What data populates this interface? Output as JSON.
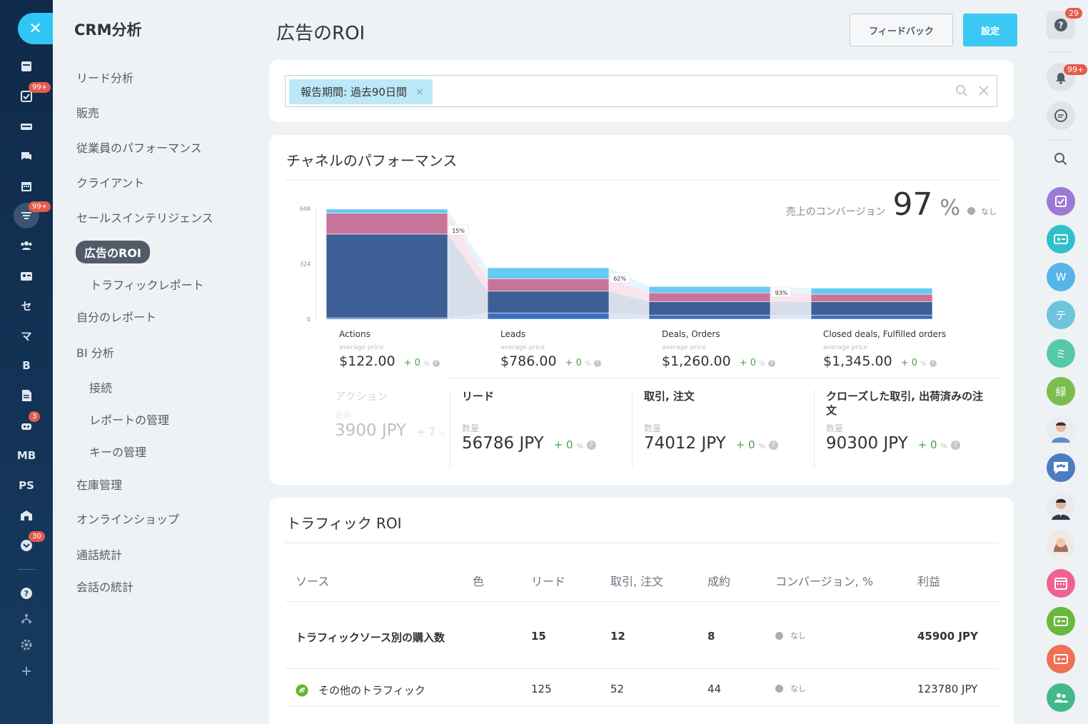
{
  "rail": {
    "close": "✕",
    "items": [
      {
        "label": "",
        "badge": ""
      },
      {
        "label": "",
        "badge": "99+"
      },
      {
        "label": "",
        "badge": ""
      },
      {
        "label": "",
        "badge": ""
      },
      {
        "label": "",
        "badge": ""
      },
      {
        "label": "",
        "badge": "99+"
      },
      {
        "label": "",
        "badge": ""
      },
      {
        "label": "",
        "badge": ""
      },
      {
        "label": "セ",
        "badge": ""
      },
      {
        "label": "マ",
        "badge": ""
      },
      {
        "label": "B",
        "badge": ""
      },
      {
        "label": "",
        "badge": ""
      },
      {
        "label": "",
        "badge": "3"
      },
      {
        "label": "MB",
        "badge": ""
      },
      {
        "label": "PS",
        "badge": ""
      },
      {
        "label": "",
        "badge": ""
      },
      {
        "label": "",
        "badge": "30"
      }
    ]
  },
  "menu": {
    "title": "CRM分析",
    "items": [
      "リード分析",
      "販売",
      "従業員のパフォーマンス",
      "クライアント",
      "セールスインテリジェンス",
      "広告のROI",
      "トラフィックレポート",
      "自分のレポート",
      "BI 分析",
      "接続",
      "レポートの管理",
      "キーの管理",
      "在庫管理",
      "オンラインショップ",
      "通話統計",
      "会話の統計"
    ]
  },
  "header": {
    "title": "広告のROI",
    "feedback": "フィードバック",
    "settings": "設定"
  },
  "filter": {
    "tag": "報告期間: 過去90日間",
    "tag_remove": "×"
  },
  "channel": {
    "title": "チャネルのパフォーマンス",
    "conversion_label": "売上のコンバージョン",
    "conversion_value": "97",
    "conversion_unit": "%",
    "conversion_none": "なし",
    "stages": [
      {
        "name": "Actions",
        "sub": "average price",
        "price": "$122.00",
        "delta": "+ 0",
        "unit": "%"
      },
      {
        "name": "Leads",
        "sub": "average price",
        "price": "$786.00",
        "delta": "+ 0",
        "unit": "%"
      },
      {
        "name": "Deals, Orders",
        "sub": "average price",
        "price": "$1,260.00",
        "delta": "+ 0",
        "unit": "%"
      },
      {
        "name": "Closed deals, Fulfilled orders",
        "sub": "average price",
        "price": "$1,345.00",
        "delta": "+ 0",
        "unit": "%"
      }
    ],
    "kpis": [
      {
        "name": "アクション",
        "sub": "価格",
        "value": "3900 JPY",
        "delta": "+ 7",
        "unit": "%"
      },
      {
        "name": "リード",
        "sub": "数量",
        "value": "56786 JPY",
        "delta": "+ 0",
        "unit": "%"
      },
      {
        "name": "取引, 注文",
        "sub": "数量",
        "value": "74012 JPY",
        "delta": "+ 0",
        "unit": "%"
      },
      {
        "name": "クローズした取引, 出荷済みの注文",
        "sub": "数量",
        "value": "90300 JPY",
        "delta": "+ 0",
        "unit": "%"
      }
    ]
  },
  "chart_data": {
    "type": "bar",
    "ylim": [
      0,
      648
    ],
    "yticks": [
      "648",
      "324",
      "0"
    ],
    "categories": [
      "Actions",
      "Leads",
      "Deals, Orders",
      "Closed deals, Fulfilled orders"
    ],
    "series": [
      {
        "values": [
          8,
          36,
          24,
          24
        ]
      },
      {
        "values": [
          490,
          128,
          78,
          78
        ]
      },
      {
        "values": [
          122,
          73,
          52,
          44
        ]
      },
      {
        "values": [
          24,
          64,
          37,
          36
        ]
      }
    ],
    "series_colors": [
      "#3a6ec2",
      "#3d5f95",
      "#c8749a",
      "#68c9f2"
    ],
    "transition_labels": [
      "15%",
      "62%",
      "93%"
    ]
  },
  "traffic": {
    "title": "トラフィック ROI",
    "columns": [
      "ソース",
      "色",
      "リード",
      "取引, 注文",
      "成約",
      "コンバージョン, %",
      "利益"
    ],
    "rows": [
      {
        "source": "トラフィックソース別の購入数",
        "leads": "15",
        "deals": "12",
        "won": "8",
        "conv": "なし",
        "profit": "45900 JPY"
      },
      {
        "source": "その他のトラフィック",
        "leads": "125",
        "deals": "52",
        "won": "44",
        "conv": "なし",
        "profit": "123780 JPY"
      }
    ]
  },
  "right_rail": {
    "help_badge": "29",
    "notif_badge": "99+",
    "avatars": [
      "W",
      "テ",
      "ミ",
      "緑"
    ]
  },
  "colors": {
    "accent": "#3bc8f5",
    "rail": "#163a5f",
    "badge": "#e35b4d"
  }
}
